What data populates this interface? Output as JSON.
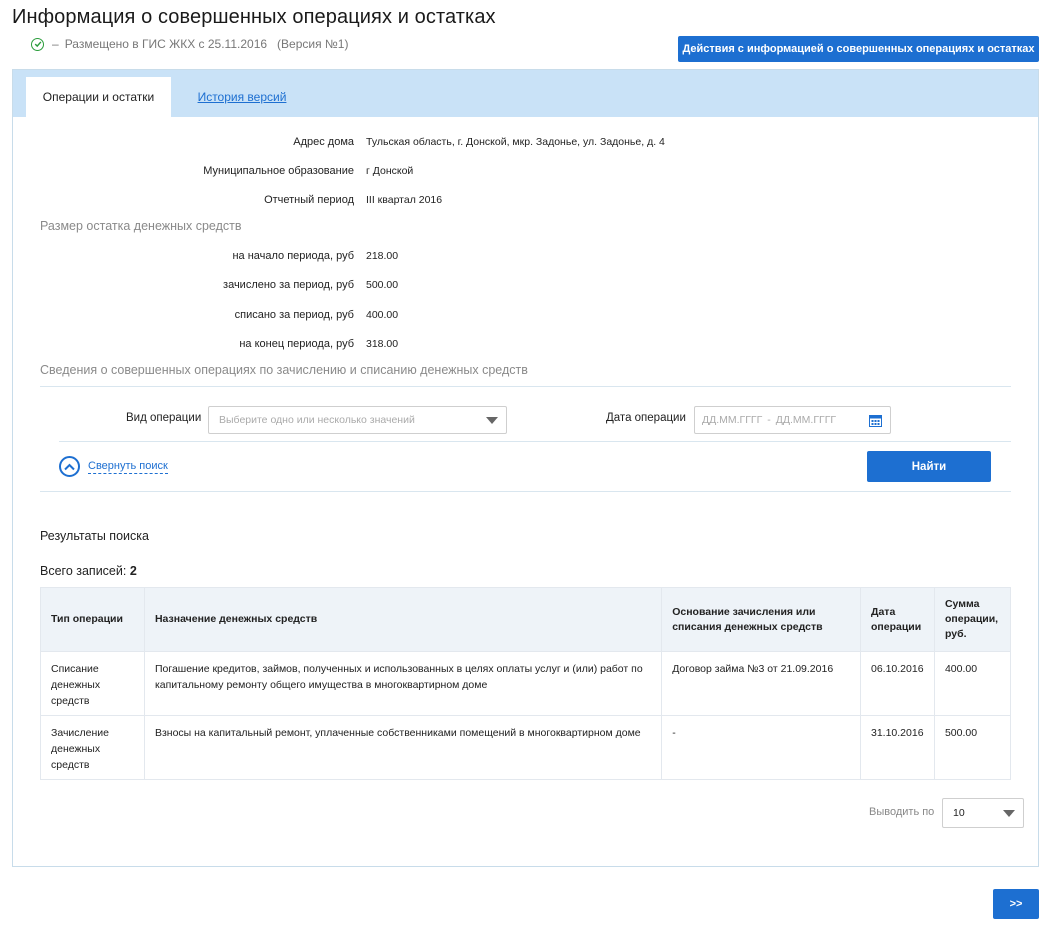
{
  "header": {
    "title": "Информация о совершенных операциях и остатках",
    "status_dash": "–",
    "status_text": "Размещено в ГИС ЖКХ с 25.11.2016",
    "version_text": "(Версия №1)",
    "actions_button": "Действия с информацией о совершенных операциях и остатках"
  },
  "tabs": {
    "active": "Операции и остатки",
    "history": "История версий"
  },
  "details": {
    "address_label": "Адрес дома",
    "address_value": "Тульская область, г. Донской, мкр. Задонье, ул. Задонье, д. 4",
    "municipality_label": "Муниципальное образование",
    "municipality_value": "г Донской",
    "period_label": "Отчетный период",
    "period_value": "III квартал 2016"
  },
  "balance": {
    "section_title": "Размер остатка денежных средств",
    "start_label": "на начало периода, руб",
    "start_value": "218.00",
    "credited_label": "зачислено за период, руб",
    "credited_value": "500.00",
    "debited_label": "списано за период, руб",
    "debited_value": "400.00",
    "end_label": "на конец периода, руб",
    "end_value": "318.00"
  },
  "operations": {
    "section_title": "Сведения о совершенных операциях по зачислению и списанию денежных средств"
  },
  "filters": {
    "op_type_label": "Вид операции",
    "op_type_placeholder": "Выберите одно или несколько значений",
    "op_date_label": "Дата операции",
    "date_from_placeholder": "ДД.ММ.ГГГГ",
    "date_sep": "-",
    "date_to_placeholder": "ДД.ММ.ГГГГ",
    "collapse_label": "Свернуть поиск",
    "find_button": "Найти"
  },
  "results": {
    "title": "Результаты поиска",
    "total_label": "Всего записей:",
    "total_count": "2",
    "columns": {
      "type": "Тип операции",
      "purpose": "Назначение денежных средств",
      "basis": "Основание зачисления или списания денежных средств",
      "date": "Дата операции",
      "sum": "Сумма операции, руб."
    },
    "rows": [
      {
        "type": "Списание денежных средств",
        "purpose": "Погашение кредитов, займов, полученных и использованных в целях оплаты услуг и (или) работ по капитальному ремонту общего имущества в многоквартирном доме",
        "basis": "Договор займа №3 от 21.09.2016",
        "date": "06.10.2016",
        "sum": "400.00"
      },
      {
        "type": "Зачисление денежных средств",
        "purpose": "Взносы на капитальный ремонт, уплаченные собственниками помещений в многоквартирном доме",
        "basis": "-",
        "date": "31.10.2016",
        "sum": "500.00"
      }
    ]
  },
  "pagination": {
    "page_size_label": "Выводить по",
    "page_size_value": "10",
    "next_button": ">>"
  },
  "colors": {
    "accent": "#1d6fd1",
    "tabbar": "#c9e2f7",
    "success": "#2a9c3b"
  }
}
